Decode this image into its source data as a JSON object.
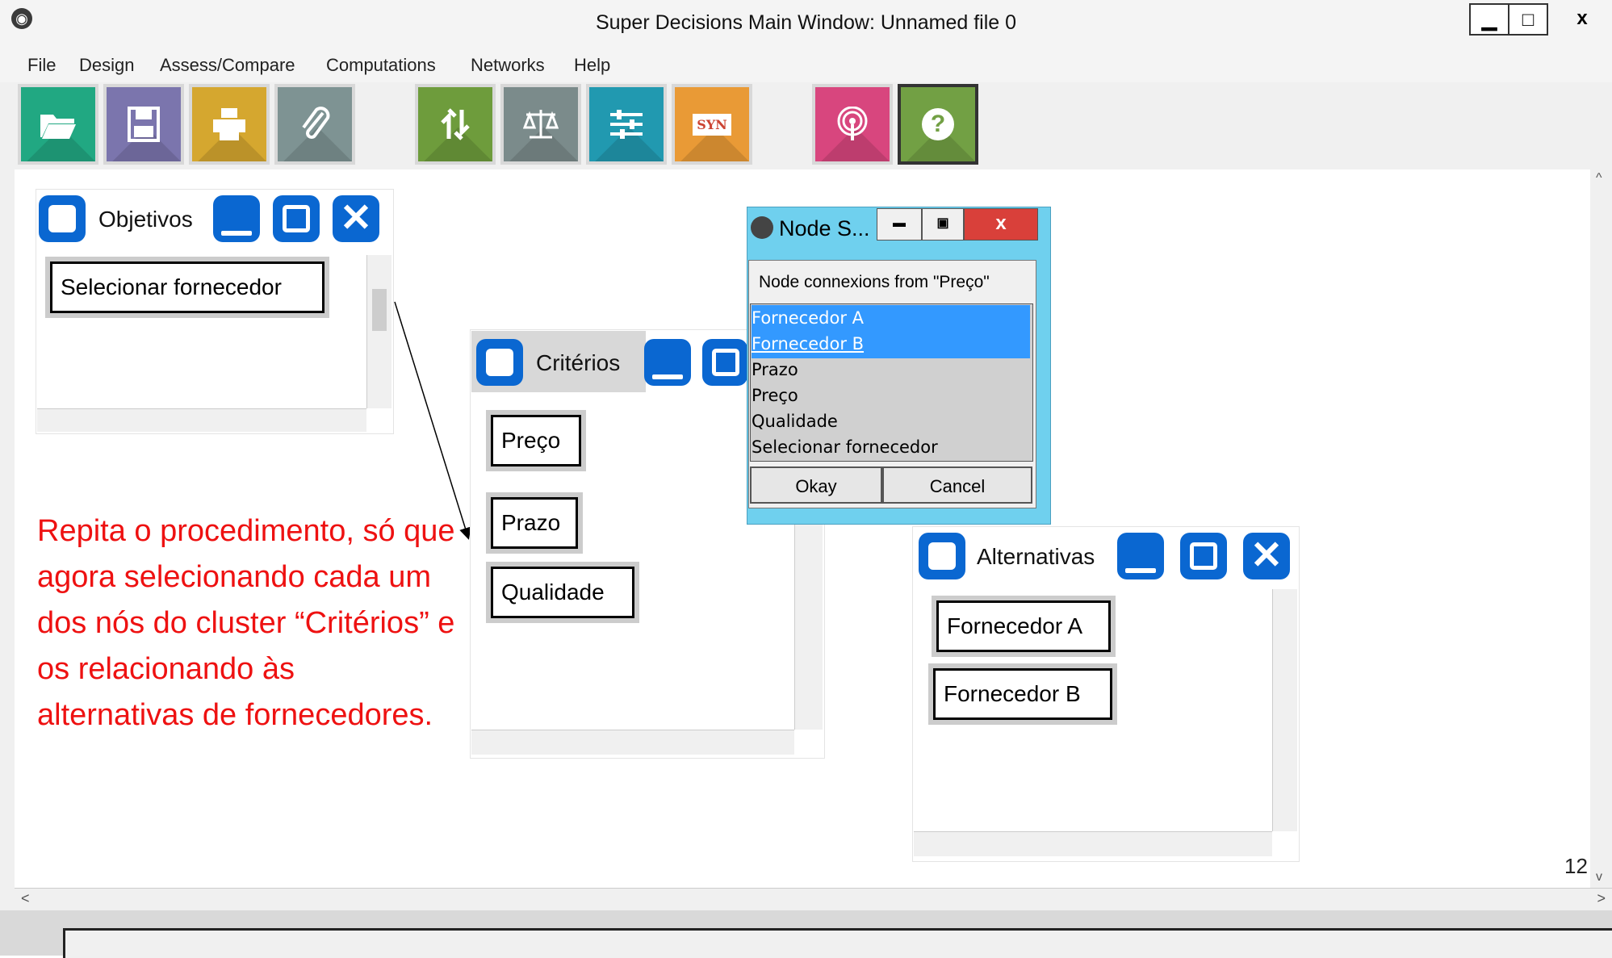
{
  "window": {
    "title": "Super Decisions Main Window: Unnamed file 0",
    "controls": {
      "minimize": "▁",
      "maximize": "□",
      "close": "x"
    }
  },
  "menu": [
    "File",
    "Design",
    "Assess/Compare",
    "Computations",
    "Networks",
    "Help"
  ],
  "toolbar": [
    {
      "name": "open-icon",
      "color": "#21a882",
      "glyph": "📂"
    },
    {
      "name": "save-icon",
      "color": "#7b75ad",
      "glyph": "▭"
    },
    {
      "name": "print-icon",
      "color": "#d5a72f",
      "glyph": "🖶"
    },
    {
      "name": "attach-icon",
      "color": "#7e9393",
      "glyph": "⊘"
    },
    {
      "name": "refresh-icon",
      "color": "#6e9c3c",
      "glyph": "⇅"
    },
    {
      "name": "balance-icon",
      "color": "#7b8b8b",
      "glyph": "⚖"
    },
    {
      "name": "sliders-icon",
      "color": "#2199b0",
      "glyph": "≡"
    },
    {
      "name": "synthesis-icon",
      "color": "#e99a36",
      "glyph": "SYN"
    },
    {
      "name": "broadcast-icon",
      "color": "#d8467e",
      "glyph": "◎"
    },
    {
      "name": "help-icon",
      "color": "#72a044",
      "glyph": "?"
    }
  ],
  "clusters": {
    "objetivos": {
      "title": "Objetivos",
      "nodes": [
        "Selecionar fornecedor"
      ]
    },
    "criterios": {
      "title": "Critérios",
      "nodes": [
        "Preço",
        "Prazo",
        "Qualidade"
      ]
    },
    "alternativas": {
      "title": "Alternativas",
      "nodes": [
        "Fornecedor A",
        "Fornecedor B"
      ]
    }
  },
  "dialog": {
    "title": "Node S...",
    "label": "Node connexions from \"Preço\"",
    "options": [
      "Fornecedor A",
      "Fornecedor B",
      "Prazo",
      "Preço",
      "Qualidade",
      "Selecionar fornecedor"
    ],
    "selected": [
      "Fornecedor A",
      "Fornecedor B"
    ],
    "ok": "Okay",
    "cancel": "Cancel",
    "controls": {
      "minimize": "▬",
      "maximize": "▣",
      "close": "x"
    }
  },
  "scroll": {
    "up": "^",
    "down": "v",
    "left": "<",
    "right": ">"
  },
  "instruction": "Repita o procedimento, só que  agora selecionando cada um dos  nós do cluster “Critérios” e os relacionando às alternativas de fornecedores.",
  "page_number": "12",
  "colors": {
    "cluster_button": "#0a67d1",
    "dialog_frame": "#6fd0ee",
    "selection": "#3399ff",
    "instruction": "#ee1111"
  }
}
